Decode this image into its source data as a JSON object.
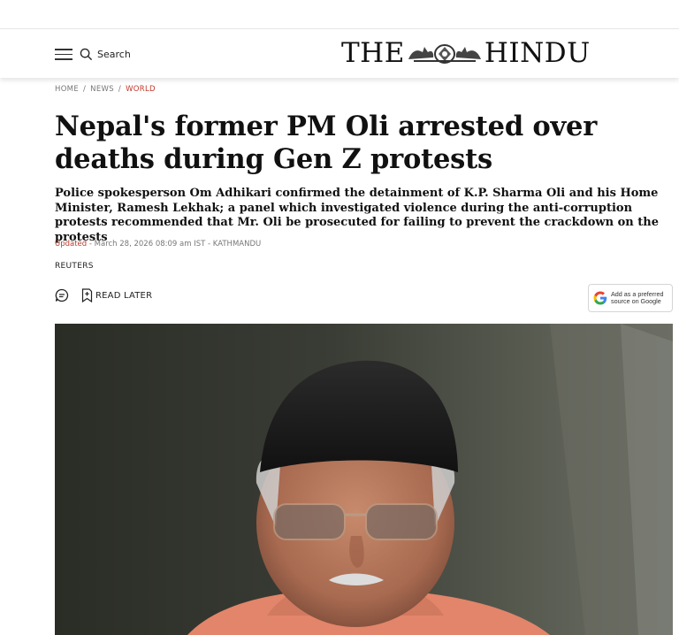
{
  "header": {
    "search_label": "Search",
    "logo_left": "THE",
    "logo_right": "HINDU",
    "menu_icon": "hamburger-menu-icon",
    "search_icon": "search-icon",
    "crest_icon": "emblem-crest-icon"
  },
  "breadcrumb": {
    "items": [
      "HOME",
      "NEWS",
      "WORLD"
    ],
    "separator": "/"
  },
  "article": {
    "headline": "Nepal's former PM Oli arrested over deaths during Gen Z protests",
    "deck": "Police spokesperson Om Adhikari confirmed the detainment of K.P. Sharma Oli and his Home Minister, Ramesh Lekhak; a panel which investigated violence during the anti-corruption protests recommended that Mr. Oli be prosecuted for failing to prevent the crackdown on the protests",
    "updated_label": "Updated",
    "date_line": " - March 28, 2026 08:09 am IST - KATHMANDU",
    "byline": "REUTERS"
  },
  "actions": {
    "comment_icon": "comment-icon",
    "read_later_icon": "bookmark-icon",
    "read_later_label": "READ LATER",
    "google_line1": "Add as a preferred",
    "google_line2": "source on Google",
    "google_icon": "google-g-icon"
  },
  "colors": {
    "accent": "#c0392b",
    "text": "#111111",
    "muted": "#777777"
  }
}
